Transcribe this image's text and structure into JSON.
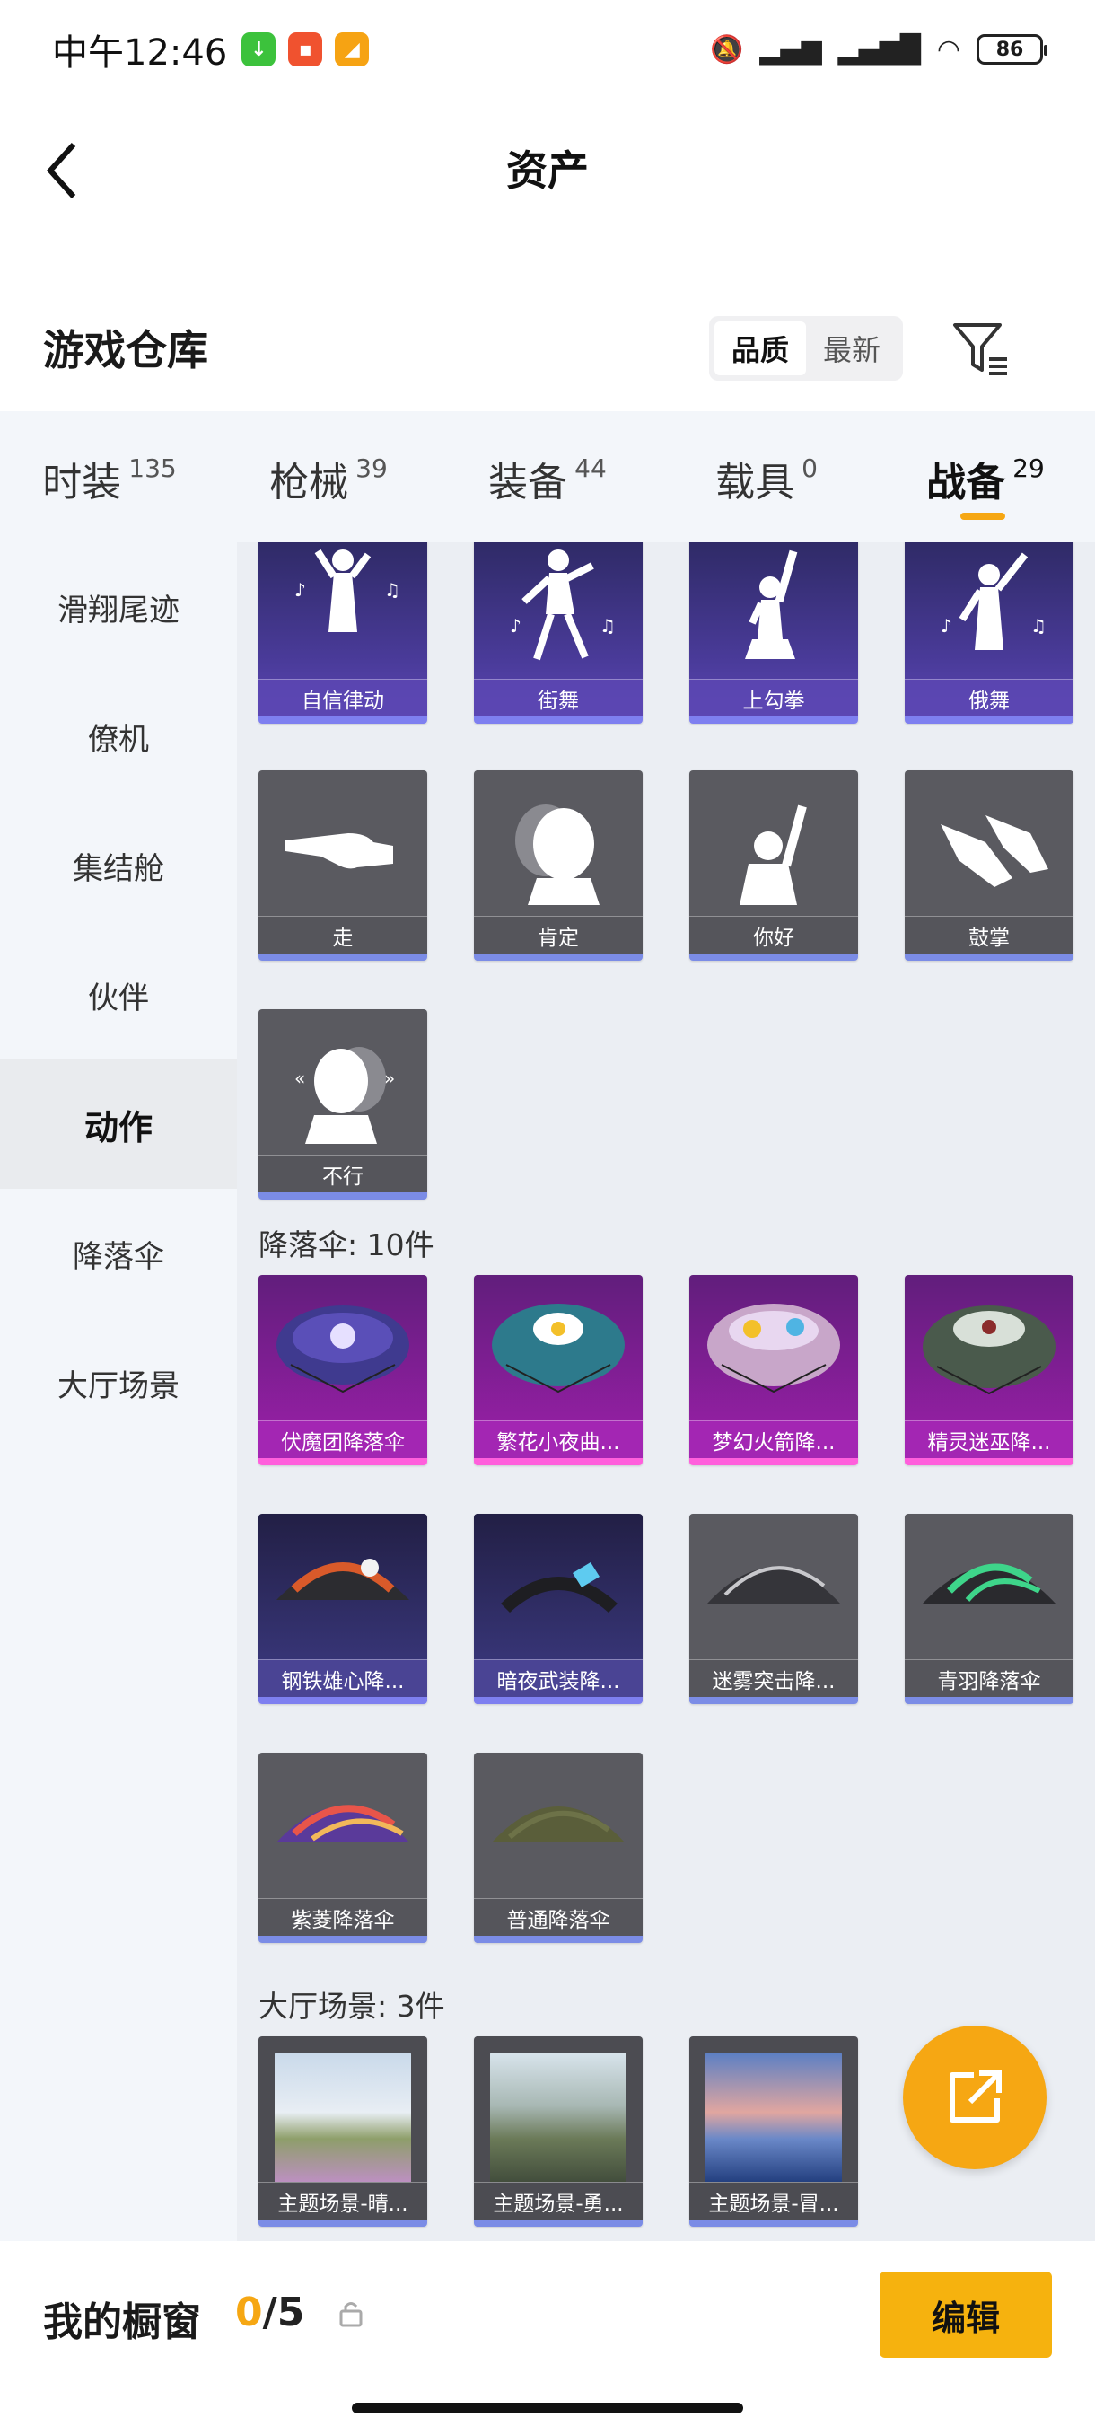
{
  "status_bar": {
    "time": "中午12:46",
    "battery": "86",
    "app_icons": [
      {
        "icon": "download-app-icon",
        "color": "#3cc23c"
      },
      {
        "icon": "red-app-icon",
        "color": "#f0522f"
      },
      {
        "icon": "orange-app-icon",
        "color": "#f6a313"
      }
    ]
  },
  "header": {
    "title": "资产"
  },
  "warehouse": {
    "title": "游戏仓库",
    "sort_options": [
      "品质",
      "最新"
    ],
    "active_sort": "品质"
  },
  "categories": [
    {
      "label": "时装",
      "count": "135"
    },
    {
      "label": "枪械",
      "count": "39"
    },
    {
      "label": "装备",
      "count": "44"
    },
    {
      "label": "载具",
      "count": "0"
    },
    {
      "label": "战备",
      "count": "29",
      "active": true
    }
  ],
  "sidebar": {
    "items": [
      "滑翔尾迹",
      "僚机",
      "集结舱",
      "伙伴",
      "动作",
      "降落伞",
      "大厅场景"
    ],
    "active": "动作"
  },
  "emotes": [
    {
      "name": "自信律动",
      "rarity": "blue"
    },
    {
      "name": "街舞",
      "rarity": "blue"
    },
    {
      "name": "上勾拳",
      "rarity": "blue"
    },
    {
      "name": "俄舞",
      "rarity": "blue"
    },
    {
      "name": "走",
      "rarity": "grey"
    },
    {
      "name": "肯定",
      "rarity": "grey"
    },
    {
      "name": "你好",
      "rarity": "grey"
    },
    {
      "name": "鼓掌",
      "rarity": "grey"
    },
    {
      "name": "不行",
      "rarity": "grey"
    }
  ],
  "parachute_section": {
    "label": "降落伞: 10件"
  },
  "parachutes": [
    {
      "name": "伏魔团降落伞",
      "rarity": "pink"
    },
    {
      "name": "繁花小夜曲...",
      "rarity": "pink"
    },
    {
      "name": "梦幻火箭降...",
      "rarity": "pink"
    },
    {
      "name": "精灵迷巫降...",
      "rarity": "pink"
    },
    {
      "name": "钢铁雄心降...",
      "rarity": "dblue"
    },
    {
      "name": "暗夜武装降...",
      "rarity": "dblue"
    },
    {
      "name": "迷雾突击降...",
      "rarity": "grey"
    },
    {
      "name": "青羽降落伞",
      "rarity": "grey"
    },
    {
      "name": "紫菱降落伞",
      "rarity": "grey"
    },
    {
      "name": "普通降落伞",
      "rarity": "grey"
    }
  ],
  "lobby_section": {
    "label": "大厅场景: 3件"
  },
  "scenes": [
    {
      "name": "主题场景-晴..."
    },
    {
      "name": "主题场景-勇..."
    },
    {
      "name": "主题场景-冒..."
    }
  ],
  "showcase": {
    "title": "我的橱窗",
    "current": "0",
    "total": "/5",
    "edit_label": "编辑"
  },
  "colors": {
    "accent": "#f6a713",
    "epic_purple": "#5c47b3",
    "legendary_pink": "#a326b3"
  }
}
